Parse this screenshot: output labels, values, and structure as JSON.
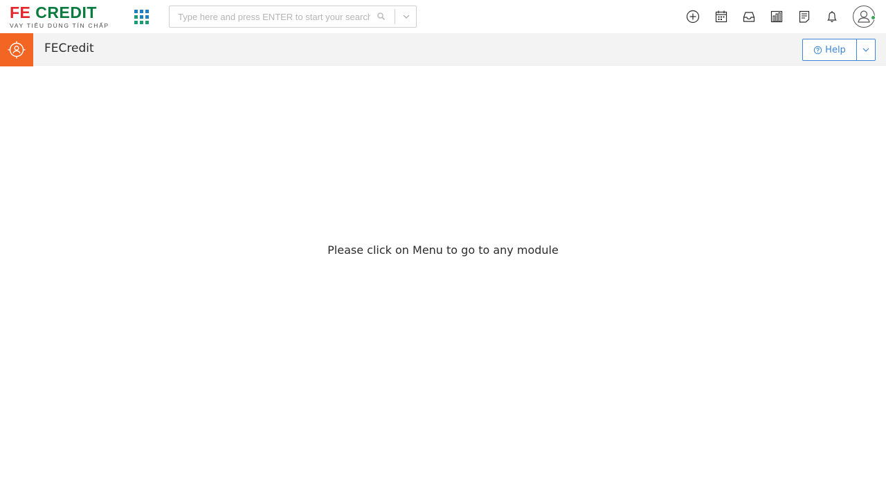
{
  "header": {
    "logo": {
      "fe": "FE",
      "credit": "CREDIT",
      "tagline": "VAY TIÊU DÙNG TÍN CHẤP"
    },
    "search": {
      "placeholder": "Type here and press ENTER to start your search",
      "value": ""
    },
    "icons": [
      "plus-circle-icon",
      "calendar-icon",
      "inbox-icon",
      "reports-icon",
      "notes-icon",
      "bell-icon",
      "user-avatar-icon"
    ],
    "colors": {
      "brand_red": "#e3262b",
      "brand_green": "#0a7b3e",
      "status_online": "#3aa655"
    }
  },
  "module_bar": {
    "title": "FECredit",
    "help_label": "Help",
    "icon": "module-target-icon",
    "accent": "#f26522",
    "link_color": "#3b86d8"
  },
  "main": {
    "message": "Please click on Menu to go to any module"
  }
}
